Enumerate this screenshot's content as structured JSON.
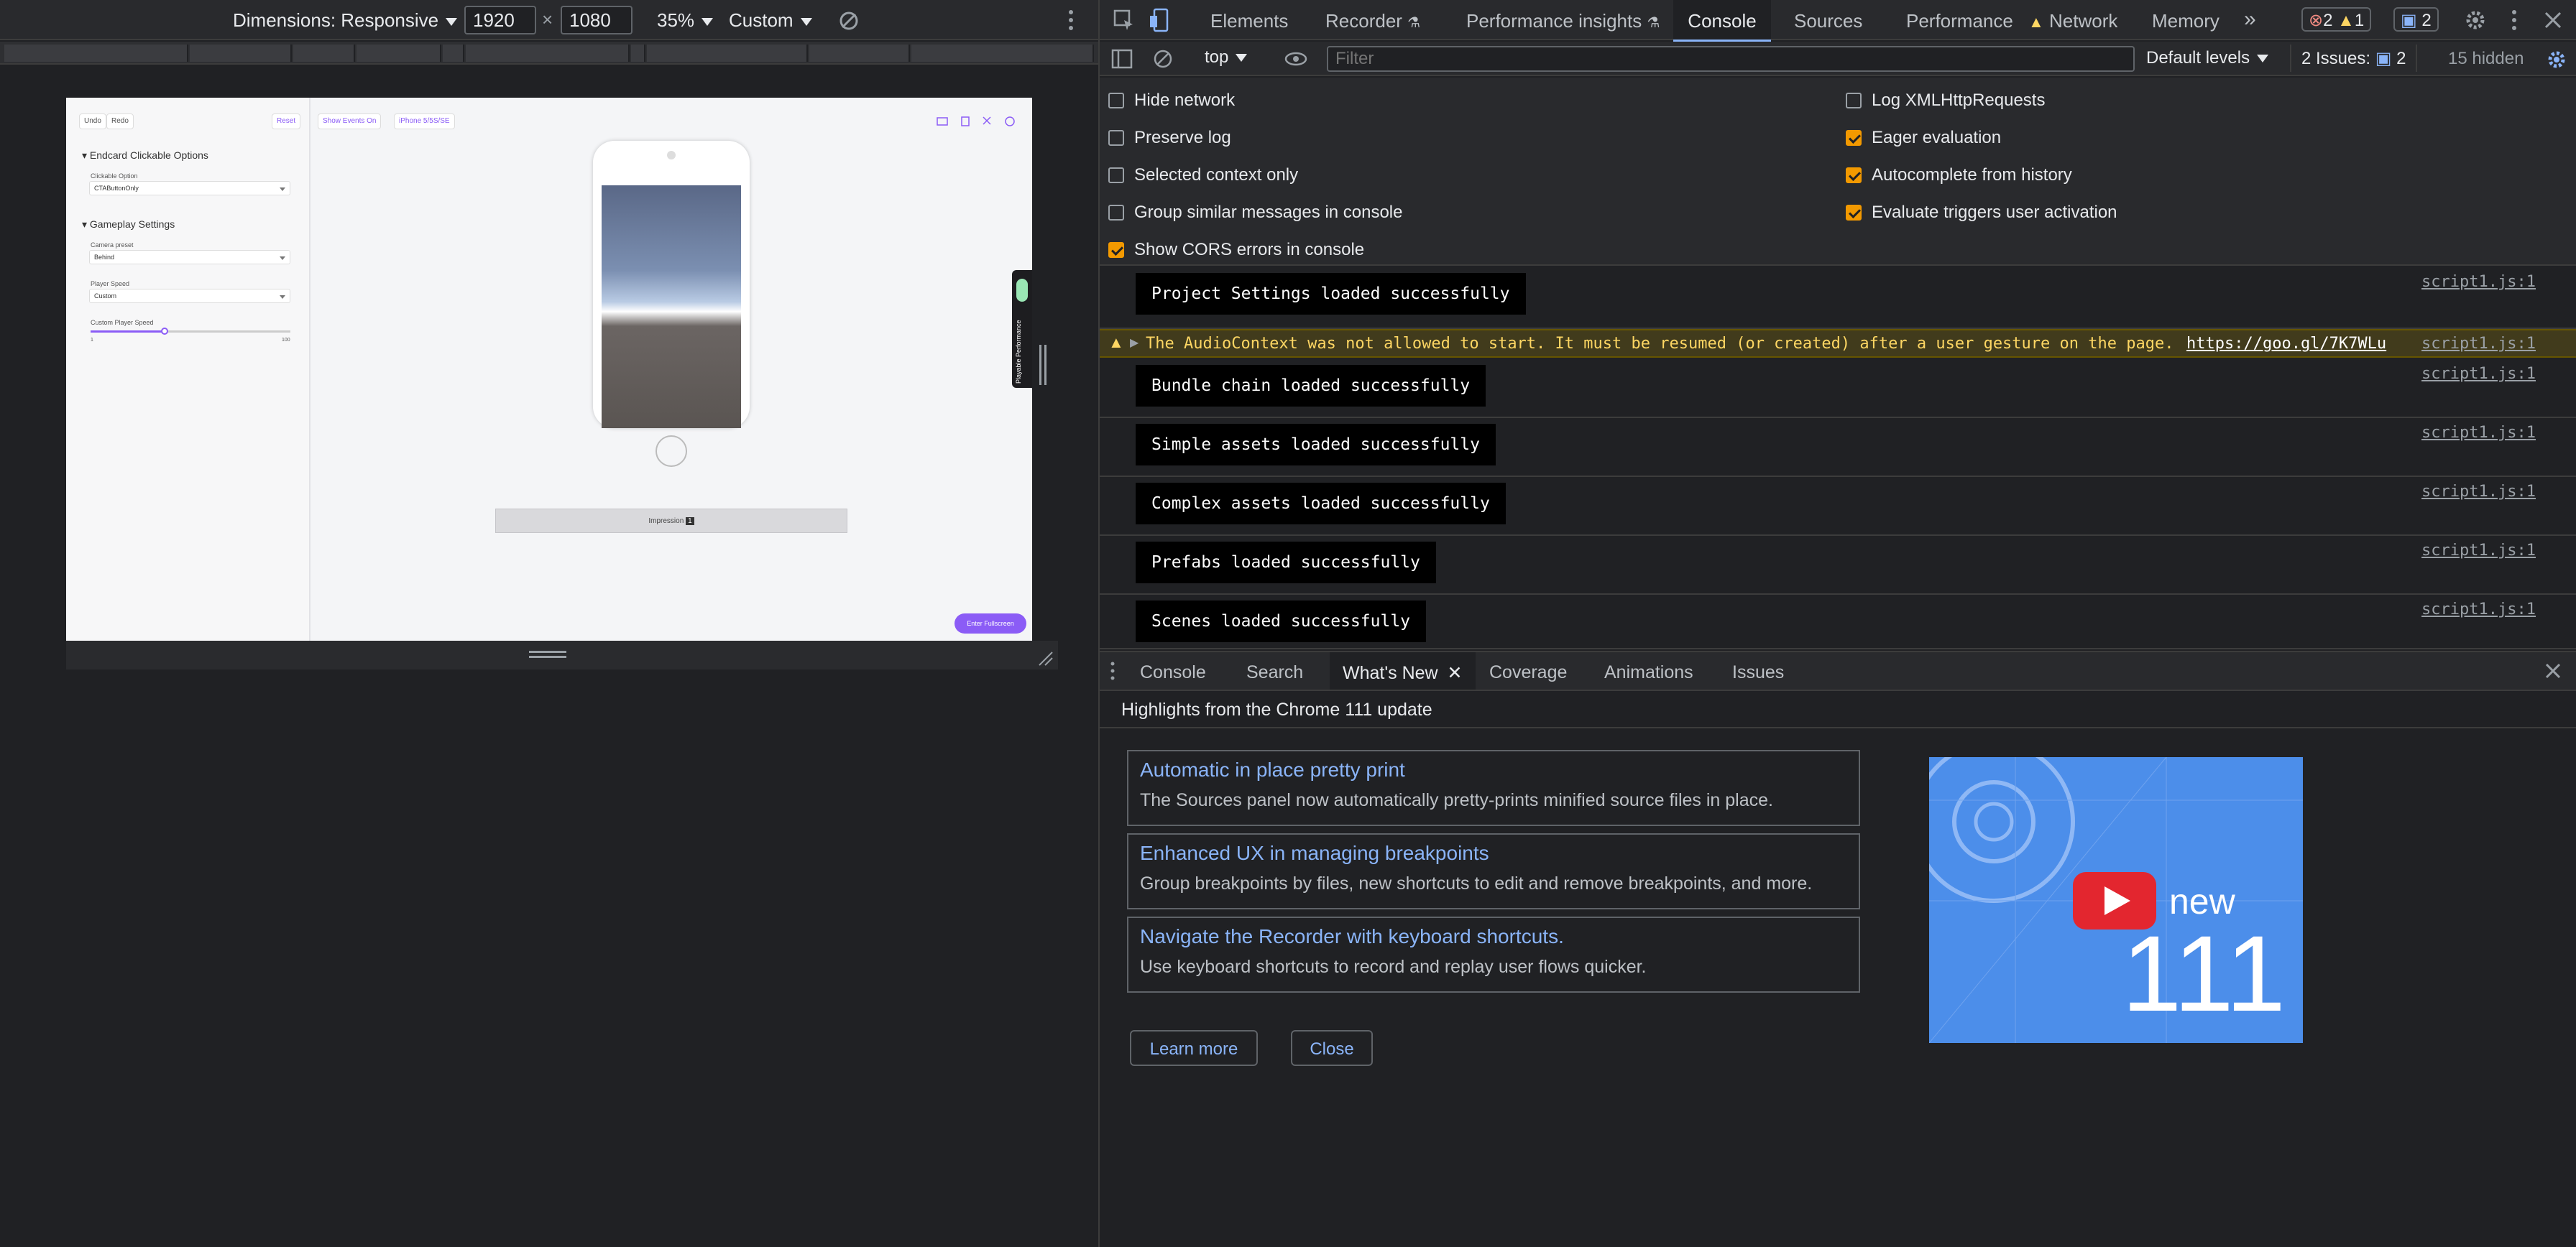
{
  "device_toolbar": {
    "dimensions_label": "Dimensions: Responsive",
    "width_value": "1920",
    "times": "×",
    "height_value": "1080",
    "zoom": "35%",
    "throttle": "Custom"
  },
  "viewport": {
    "undo": "Undo",
    "redo": "Redo",
    "reset": "Reset",
    "show_events": "Show Events On",
    "device": "iPhone 5/5S/SE",
    "section1": "Endcard Clickable Options",
    "clickable_option_label": "Clickable Option",
    "clickable_option_value": "CTAButtonOnly",
    "section2": "Gameplay Settings",
    "camera_label": "Camera preset",
    "camera_value": "Behind",
    "player_speed_label": "Player Speed",
    "player_speed_value": "Custom",
    "custom_speed_label": "Custom Player Speed",
    "slider_min": "1",
    "slider_max": "100",
    "slider_level": 0.37,
    "impression": "Impression",
    "impression_count": "1",
    "fullscreen": "Enter Fullscreen",
    "side_tab": "Playable Performance"
  },
  "devtools": {
    "tabs": [
      "Elements",
      "Recorder",
      "Performance insights",
      "Console",
      "Sources",
      "Performance",
      "Network",
      "Memory"
    ],
    "active_tab": "Console",
    "more": "»",
    "errors": "2",
    "warnings": "1",
    "info": "2"
  },
  "console_toolbar": {
    "context": "top",
    "filter_placeholder": "Filter",
    "levels": "Default levels",
    "issues_label": "2 Issues:",
    "issues_count": "2",
    "hidden": "15 hidden"
  },
  "settings": {
    "left": [
      {
        "label": "Hide network",
        "checked": false
      },
      {
        "label": "Preserve log",
        "checked": false
      },
      {
        "label": "Selected context only",
        "checked": false
      },
      {
        "label": "Group similar messages in console",
        "checked": false
      },
      {
        "label": "Show CORS errors in console",
        "checked": true
      }
    ],
    "right": [
      {
        "label": "Log XMLHttpRequests",
        "checked": false
      },
      {
        "label": "Eager evaluation",
        "checked": true
      },
      {
        "label": "Autocomplete from history",
        "checked": true
      },
      {
        "label": "Evaluate triggers user activation",
        "checked": true
      }
    ]
  },
  "messages": [
    {
      "text": "Project Settings loaded successfully",
      "source": "script1.js:1"
    },
    {
      "text": "The AudioContext was not allowed to start. It must be resumed (or created) after a user gesture on the page.",
      "link": "https://goo.gl/7K7WLu",
      "source": "script1.js:1",
      "level": "warning"
    },
    {
      "text": "Bundle chain loaded successfully",
      "source": "script1.js:1"
    },
    {
      "text": "Simple assets loaded successfully",
      "source": "script1.js:1"
    },
    {
      "text": "Complex assets loaded successfully",
      "source": "script1.js:1"
    },
    {
      "text": "Prefabs loaded successfully",
      "source": "script1.js:1"
    },
    {
      "text": "Scenes loaded successfully",
      "source": "script1.js:1"
    }
  ],
  "drawer": {
    "tabs": [
      "Console",
      "Search",
      "What's New",
      "Coverage",
      "Animations",
      "Issues"
    ],
    "active": "What's New",
    "header": "Highlights from the Chrome 111 update",
    "cards": [
      {
        "title": "Automatic in place pretty print",
        "desc": "The Sources panel now automatically pretty-prints minified source files in place."
      },
      {
        "title": "Enhanced UX in managing breakpoints",
        "desc": "Group breakpoints by files, new shortcuts to edit and remove breakpoints, and more."
      },
      {
        "title": "Navigate the Recorder with keyboard shortcuts.",
        "desc": "Use keyboard shortcuts to record and replay user flows quicker."
      }
    ],
    "learn_more": "Learn more",
    "close": "Close",
    "thumb_new": "new",
    "thumb_version": "111"
  },
  "colors": {
    "accent": "#8ab4f8",
    "warning_bg": "#413b1c",
    "checkbox": "#f29900",
    "brand_purple": "#8b5cf6"
  }
}
